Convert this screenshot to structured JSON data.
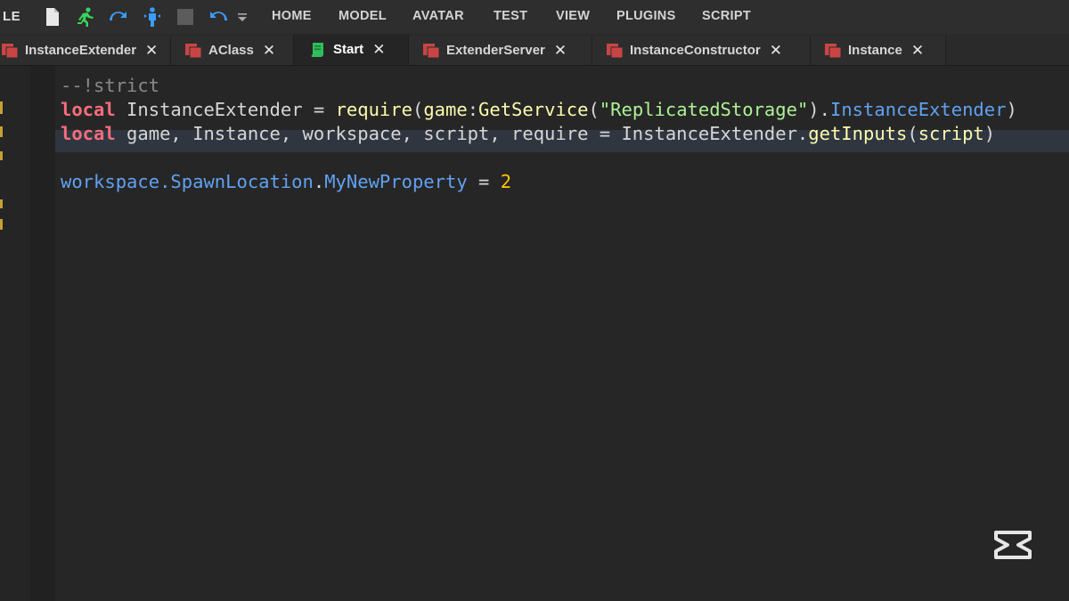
{
  "toolbar": {
    "file_label": "LE",
    "quick_access_icons": [
      "new-file-icon",
      "run-icon",
      "redo-icon",
      "play-here-icon",
      "stop-icon",
      "undo-icon",
      "customize-dropdown-icon"
    ],
    "menu": [
      "HOME",
      "MODEL",
      "AVATAR",
      "TEST",
      "VIEW",
      "PLUGINS",
      "SCRIPT"
    ]
  },
  "tabs": [
    {
      "label": "InstanceExtender",
      "icon": "module-script-icon",
      "active": false
    },
    {
      "label": "AClass",
      "icon": "module-script-icon",
      "active": false
    },
    {
      "label": "Start",
      "icon": "script-icon",
      "active": true
    },
    {
      "label": "ExtenderServer",
      "icon": "module-script-icon",
      "active": false
    },
    {
      "label": "InstanceConstructor",
      "icon": "module-script-icon",
      "active": false
    },
    {
      "label": "Instance",
      "icon": "module-script-icon",
      "active": false
    }
  ],
  "tab_close_glyph": "✕",
  "code": {
    "lines": [
      "--!strict",
      "local InstanceExtender = require(game:GetService(\"ReplicatedStorage\").InstanceExtender)",
      "local game, Instance, workspace, script, require = InstanceExtender.getInputs(script)",
      "",
      "workspace.SpawnLocation.MyNewProperty = 2",
      ""
    ],
    "tokens": {
      "l1_comment": "--!strict",
      "l2_kw": "local",
      "l2_var": " InstanceExtender = ",
      "l2_fn_require": "require",
      "l2_p1": "(",
      "l2_game": "game",
      "l2_colon": ":",
      "l2_fn_getservice": "GetService",
      "l2_p2": "(",
      "l2_str": "\"ReplicatedStorage\"",
      "l2_p3": ").",
      "l2_prop": "InstanceExtender",
      "l2_p4": ")",
      "l3_kw": "local",
      "l3_vars": " game, Instance, workspace, script, require = InstanceExtender.",
      "l3_fn": "getInputs",
      "l3_p1": "(",
      "l3_arg": "script",
      "l3_p2": ")",
      "l5_ws": "workspace.",
      "l5_prop1": "SpawnLocation",
      "l5_dot": ".",
      "l5_prop2": "MyNewProperty",
      "l5_eq": " = ",
      "l5_num": "2"
    }
  },
  "colors": {
    "keyword": "#f86d7c",
    "builtin_function": "#fdfbac",
    "property": "#61a1f1",
    "string": "#adf195",
    "number": "#ffc600",
    "comment": "#8a8a8a",
    "text": "#d6d6d6",
    "module_script_icon": "#c94545",
    "script_icon": "#2fbe5b"
  },
  "watermark_icon": "capcut-logo-icon"
}
